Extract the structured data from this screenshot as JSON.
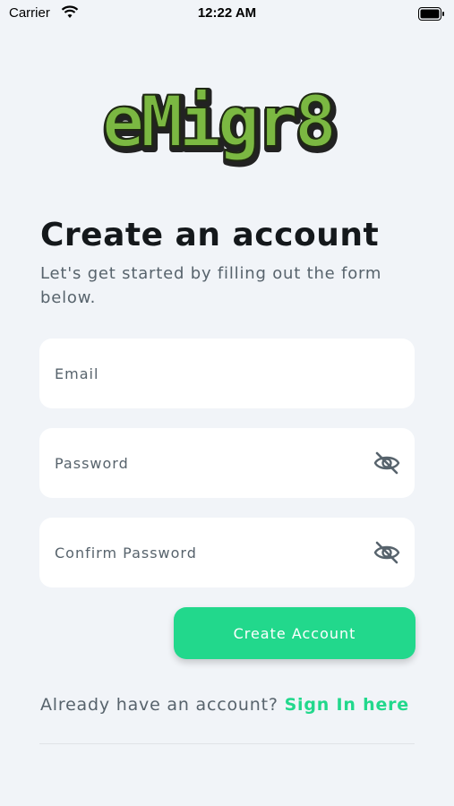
{
  "status_bar": {
    "carrier": "Carrier",
    "time": "12:22 AM"
  },
  "logo": {
    "text": "eMigr8",
    "color": "#7bb842"
  },
  "header": {
    "title": "Create an account",
    "subtitle": "Let's get started by filling out the form below."
  },
  "form": {
    "email_placeholder": "Email",
    "password_placeholder": "Password",
    "confirm_password_placeholder": "Confirm Password",
    "submit_label": "Create Account"
  },
  "signin": {
    "prompt": "Already have an account?",
    "link_label": "Sign In here"
  },
  "colors": {
    "background": "#f1f4f8",
    "accent": "#22d88c",
    "field": "#ffffff",
    "text_primary": "#14181b",
    "text_secondary": "#57636c"
  }
}
